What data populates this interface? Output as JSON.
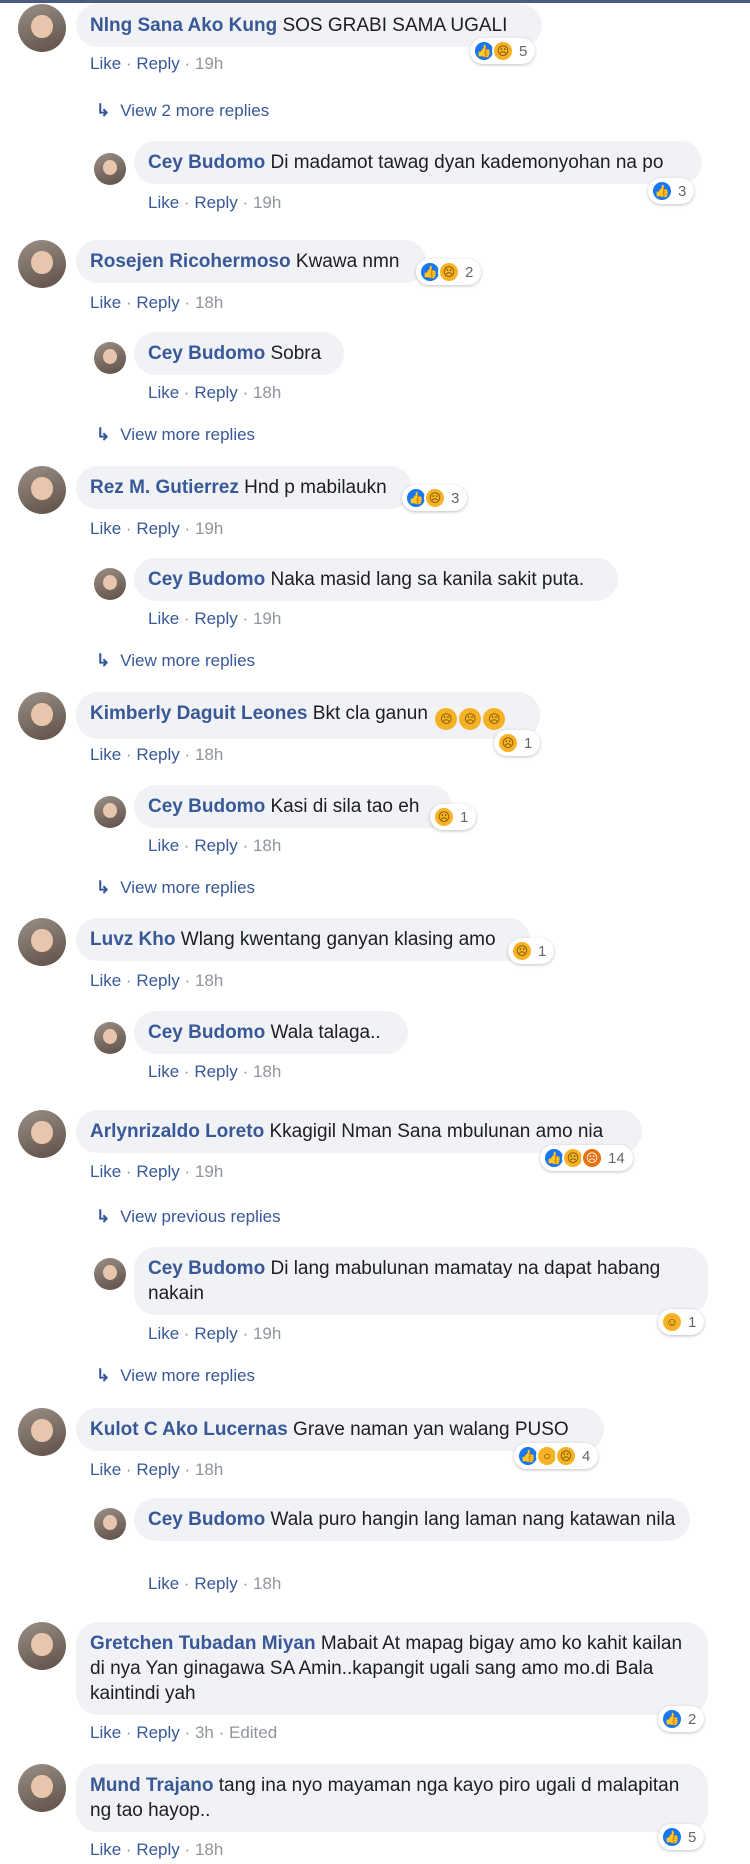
{
  "comments": [
    {
      "name": "Nlng Sana Ako Kung",
      "text": "SOS GRABI SAMA UGALI",
      "like": "Like",
      "sep": "·",
      "reply": "Reply",
      "time": "19h",
      "reactions": "5"
    },
    {
      "view": "View 2 more replies"
    },
    {
      "name": "Cey Budomo",
      "text": "Di madamot tawag dyan kademonyohan na po",
      "like": "Like",
      "sep": "·",
      "reply": "Reply",
      "time": "19h",
      "reactions": "3"
    },
    {
      "name": "Rosejen Ricohermoso",
      "text": "Kwawa nmn",
      "like": "Like",
      "sep": "·",
      "reply": "Reply",
      "time": "18h",
      "reactions": "2"
    },
    {
      "name": "Cey Budomo",
      "text": "Sobra",
      "like": "Like",
      "sep": "·",
      "reply": "Reply",
      "time": "18h"
    },
    {
      "view": "View more replies"
    },
    {
      "name": "Rez M. Gutierrez",
      "text": "Hnd p mabilaukn",
      "like": "Like",
      "sep": "·",
      "reply": "Reply",
      "time": "19h",
      "reactions": "3"
    },
    {
      "name": "Cey Budomo",
      "text": "Naka masid lang sa kanila sakit puta.",
      "like": "Like",
      "sep": "·",
      "reply": "Reply",
      "time": "19h"
    },
    {
      "view": "View more replies"
    },
    {
      "name": "Kimberly Daguit Leones",
      "text": "Bkt cla ganun",
      "like": "Like",
      "sep": "·",
      "reply": "Reply",
      "time": "18h",
      "reactions": "1"
    },
    {
      "name": "Cey Budomo",
      "text": "Kasi di sila tao eh",
      "like": "Like",
      "sep": "·",
      "reply": "Reply",
      "time": "18h",
      "reactions": "1"
    },
    {
      "view": "View more replies"
    },
    {
      "name": "Luvz Kho",
      "text": "Wlang kwentang ganyan klasing amo",
      "like": "Like",
      "sep": "·",
      "reply": "Reply",
      "time": "18h",
      "reactions": "1"
    },
    {
      "name": "Cey Budomo",
      "text": "Wala talaga..",
      "like": "Like",
      "sep": "·",
      "reply": "Reply",
      "time": "18h"
    },
    {
      "name": "Arlynrizaldo Loreto",
      "text": "Kkagigil Nman Sana mbulunan amo nia",
      "like": "Like",
      "sep": "·",
      "reply": "Reply",
      "time": "19h",
      "reactions": "14"
    },
    {
      "view": "View previous replies"
    },
    {
      "name": "Cey Budomo",
      "text": "Di lang mabulunan mamatay na dapat habang nakain",
      "like": "Like",
      "sep": "·",
      "reply": "Reply",
      "time": "19h",
      "reactions": "1"
    },
    {
      "view": "View more replies"
    },
    {
      "name": "Kulot C Ako Lucernas",
      "text": "Grave naman yan walang PUSO",
      "like": "Like",
      "sep": "·",
      "reply": "Reply",
      "time": "18h",
      "reactions": "4"
    },
    {
      "name": "Cey Budomo",
      "text": "Wala puro hangin lang laman nang katawan nila",
      "like": "Like",
      "sep": "·",
      "reply": "Reply",
      "time": "18h"
    },
    {
      "name": "Gretchen Tubadan Miyan",
      "text": "Mabait At mapag bigay amo ko kahit kailan di nya Yan ginagawa SA Amin..kapangit ugali sang amo mo.di Bala kaintindi yah",
      "like": "Like",
      "sep": "·",
      "reply": "Reply",
      "time": "3h",
      "edited": "· Edited",
      "reactions": "2"
    },
    {
      "name": "Mund Trajano",
      "text": "tang ina nyo mayaman nga kayo piro ugali d malapitan ng tao hayop..",
      "like": "Like",
      "sep": "·",
      "reply": "Reply",
      "time": "18h",
      "reactions": "5"
    }
  ]
}
